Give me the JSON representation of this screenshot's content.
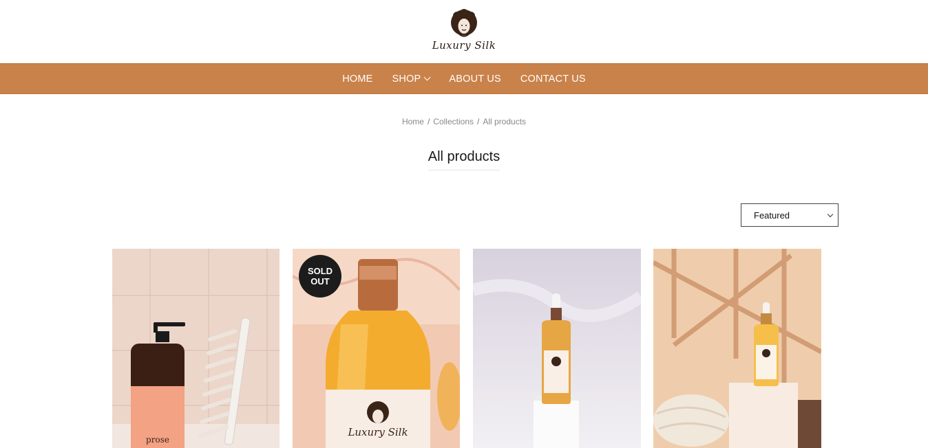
{
  "brand": {
    "logo_text": "Luxury Silk"
  },
  "nav": {
    "items": [
      {
        "label": "HOME"
      },
      {
        "label": "SHOP"
      },
      {
        "label": "ABOUT US"
      },
      {
        "label": "CONTACT US"
      }
    ]
  },
  "breadcrumb": {
    "home": "Home",
    "collections": "Collections",
    "current": "All products",
    "separator": "/"
  },
  "page": {
    "title": "All products"
  },
  "sort": {
    "selected": "Featured"
  },
  "products": [
    {
      "badge": "",
      "label_text": "prose"
    },
    {
      "badge": "SOLD OUT",
      "label_text": "Luxury Silk"
    },
    {
      "badge": "",
      "label_text": ""
    },
    {
      "badge": "",
      "label_text": ""
    }
  ],
  "colors": {
    "nav_bg": "#c9824a",
    "badge_bg": "#1c1c1c"
  }
}
